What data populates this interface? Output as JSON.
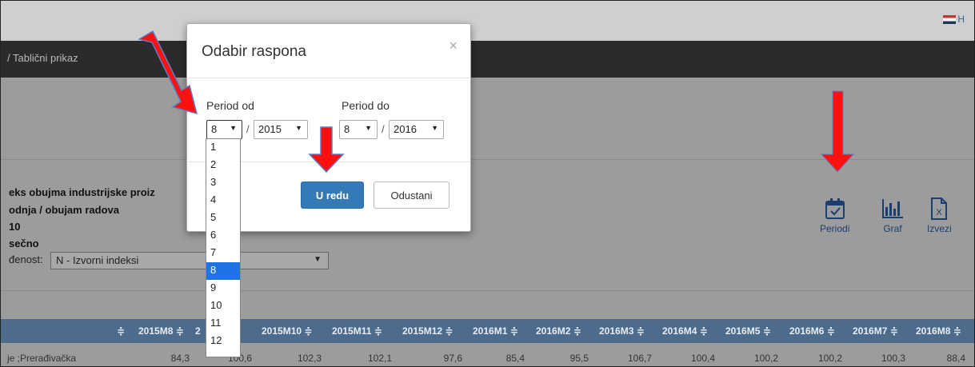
{
  "header": {
    "language_label": "H"
  },
  "breadcrumb": {
    "separator": "/",
    "current": "Tablični prikaz"
  },
  "report": {
    "line1": "eks obujma industrijske proiz",
    "line2": "odnja / obujam radova",
    "line3": "10",
    "line4": "sečno",
    "adjust_label": "đenost:",
    "adjust_value": "N - Izvorni indeksi"
  },
  "tools": [
    {
      "label": "Periodi",
      "icon": "calendar-check-icon"
    },
    {
      "label": "Graf",
      "icon": "bar-chart-icon"
    },
    {
      "label": "Izvezi",
      "icon": "excel-export-icon"
    }
  ],
  "table": {
    "headers": [
      "2015M8 ≑",
      "2",
      "2015M10 ≑",
      "2015M11 ≑",
      "2015M12 ≑",
      "2016M1 ≑",
      "2016M2 ≑",
      "2016M3 ≑",
      "2016M4 ≑",
      "2016M5 ≑",
      "2016M6 ≑",
      "2016M7 ≑",
      "2016M8 ≑"
    ],
    "first_header_sort": "≑",
    "row_label": "je ;Prerađivačka",
    "row_values": [
      "84,3",
      "100,6",
      "102,3",
      "102,1",
      "97,6",
      "85,4",
      "95,5",
      "106,7",
      "100,4",
      "100,2",
      "100,2",
      "100,3",
      "88,4"
    ]
  },
  "modal": {
    "title": "Odabir raspona",
    "close": "×",
    "from_label": "Period od",
    "to_label": "Period do",
    "from_month": "8",
    "from_year": "2015",
    "to_month": "8",
    "to_year": "2016",
    "separator": "/",
    "ok_label": "U redu",
    "cancel_label": "Odustani"
  },
  "month_options": [
    "1",
    "2",
    "3",
    "4",
    "5",
    "6",
    "7",
    "8",
    "9",
    "10",
    "11",
    "12"
  ],
  "selected_month": "8",
  "colors": {
    "accent": "#337ab7",
    "highlight": "#1e73e8",
    "arrow": "#ff0000",
    "table_header": "#4d6b8a"
  }
}
